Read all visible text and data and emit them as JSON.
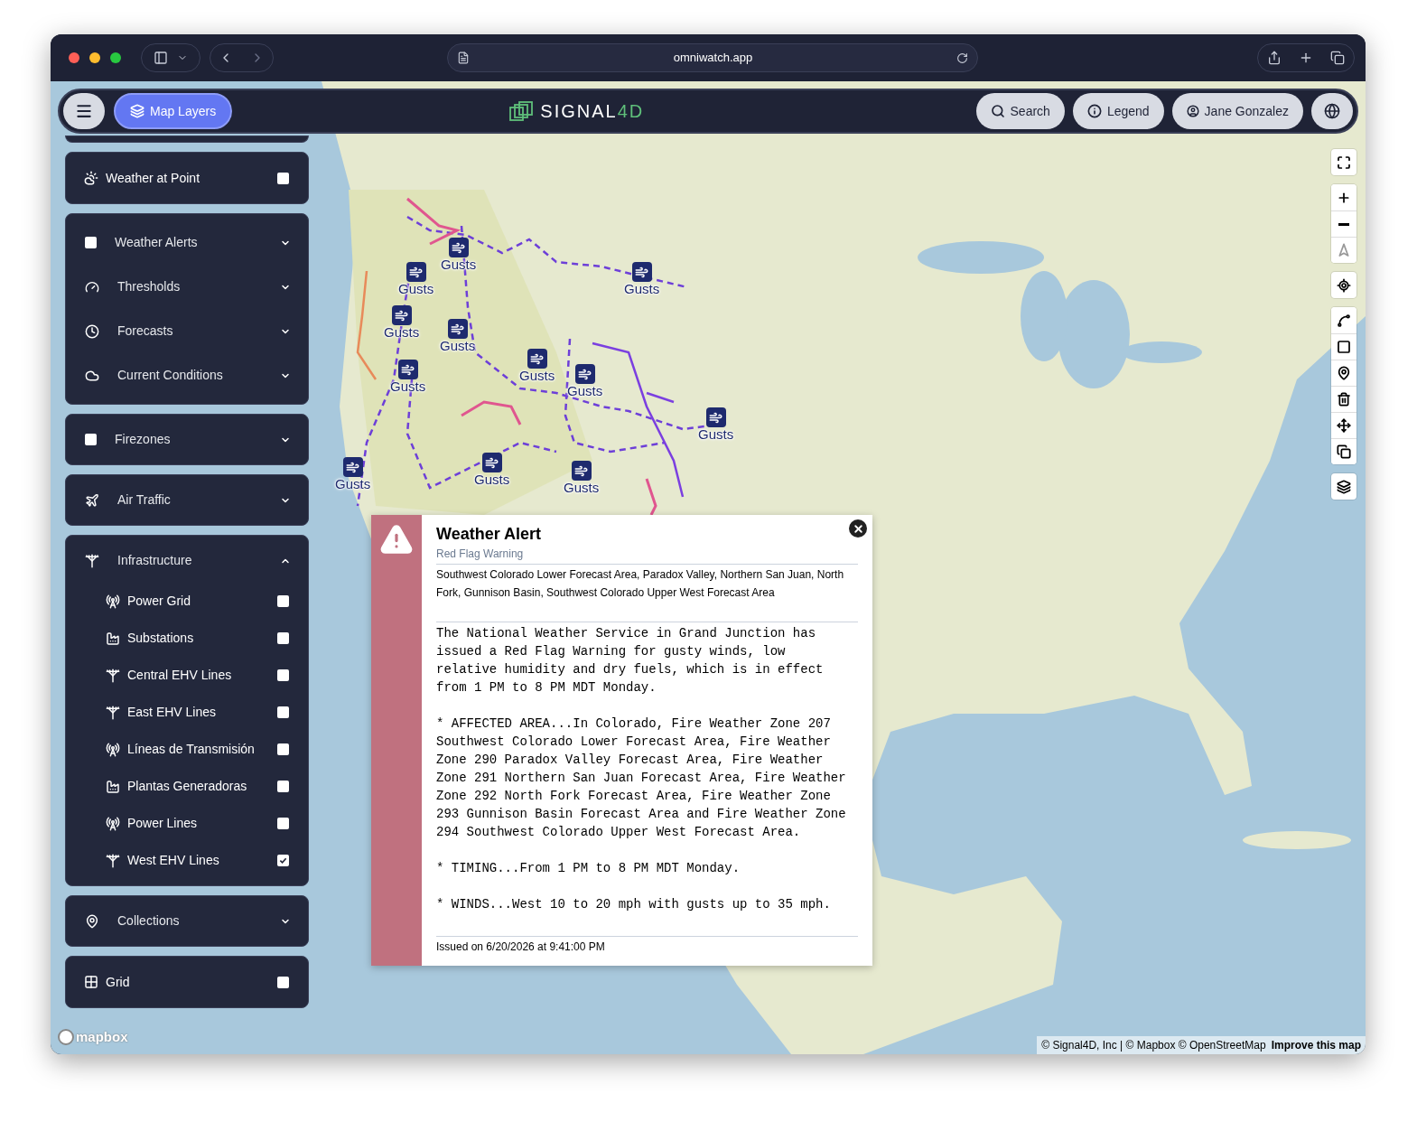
{
  "browser": {
    "url": "omniwatch.app"
  },
  "header": {
    "layers_button": "Map Layers",
    "logo": {
      "text": "SIGNAL",
      "accent": "4D"
    },
    "search_button": "Search",
    "legend_button": "Legend",
    "user_button": "Jane Gonzalez"
  },
  "sidebar": {
    "cards": [
      {
        "items": [
          {
            "kind": "toggle",
            "label": "Weather at Point",
            "checked": false
          }
        ]
      },
      {
        "items": [
          {
            "kind": "check_group",
            "label": "Weather Alerts",
            "checked": false,
            "expanded": false
          },
          {
            "kind": "group",
            "label": "Thresholds",
            "expanded": false
          },
          {
            "kind": "group",
            "label": "Forecasts",
            "expanded": false
          },
          {
            "kind": "group",
            "label": "Current Conditions",
            "expanded": false
          }
        ]
      },
      {
        "items": [
          {
            "kind": "check_group",
            "label": "Firezones",
            "checked": false,
            "expanded": false
          }
        ]
      },
      {
        "items": [
          {
            "kind": "group",
            "label": "Air Traffic",
            "expanded": false
          }
        ]
      },
      {
        "items": [
          {
            "kind": "group",
            "label": "Infrastructure",
            "expanded": true,
            "children": [
              {
                "kind": "toggle",
                "label": "Power Grid",
                "checked": false
              },
              {
                "kind": "toggle",
                "label": "Substations",
                "checked": false
              },
              {
                "kind": "toggle",
                "label": "Central EHV Lines",
                "checked": false
              },
              {
                "kind": "toggle",
                "label": "East EHV Lines",
                "checked": false
              },
              {
                "kind": "toggle",
                "label": "Líneas de Transmisión",
                "checked": false
              },
              {
                "kind": "toggle",
                "label": "Plantas Generadoras",
                "checked": false
              },
              {
                "kind": "toggle",
                "label": "Power Lines",
                "checked": false
              },
              {
                "kind": "toggle",
                "label": "West EHV Lines",
                "checked": true
              }
            ]
          }
        ]
      },
      {
        "items": [
          {
            "kind": "group",
            "label": "Collections",
            "expanded": false
          }
        ]
      },
      {
        "items": [
          {
            "kind": "toggle",
            "label": "Grid",
            "checked": false
          }
        ]
      }
    ]
  },
  "map": {
    "markers": [
      {
        "label": "Gusts"
      },
      {
        "label": "Gusts"
      },
      {
        "label": "Gusts"
      },
      {
        "label": "Gusts"
      },
      {
        "label": "Gusts"
      },
      {
        "label": "Gusts"
      },
      {
        "label": "Gusts"
      },
      {
        "label": "Gusts"
      },
      {
        "label": "Gusts"
      },
      {
        "label": "Gusts"
      },
      {
        "label": "Gusts"
      },
      {
        "label": "Gusts"
      }
    ],
    "logo": "mapbox",
    "attribution": "© Signal4D, Inc | © Mapbox © OpenStreetMap",
    "improve_link": "Improve this map"
  },
  "popup": {
    "title": "Weather Alert",
    "subtitle": "Red Flag Warning",
    "areas": "Southwest Colorado Lower Forecast Area, Paradox Valley, Northern San Juan, North Fork, Gunnison Basin, Southwest Colorado Upper West Forecast Area",
    "body": [
      "The National Weather Service in Grand Junction has issued a Red Flag Warning for gusty winds, low relative humidity and dry fuels, which is in effect from 1 PM to 8 PM MDT Monday.",
      "* AFFECTED AREA...In Colorado, Fire Weather Zone 207 Southwest Colorado Lower Forecast Area, Fire Weather Zone 290 Paradox Valley Forecast Area, Fire Weather Zone 291 Northern San Juan Forecast Area, Fire Weather Zone 292 North Fork Forecast Area, Fire Weather Zone 293 Gunnison Basin Forecast Area and Fire Weather Zone 294 Southwest Colorado Upper West Forecast Area.",
      "* TIMING...From 1 PM to 8 PM MDT Monday.",
      "* WINDS...West 10 to 20 mph with gusts up to 35 mph."
    ],
    "issued": "Issued on 6/20/2026 at 9:41:00 PM"
  }
}
